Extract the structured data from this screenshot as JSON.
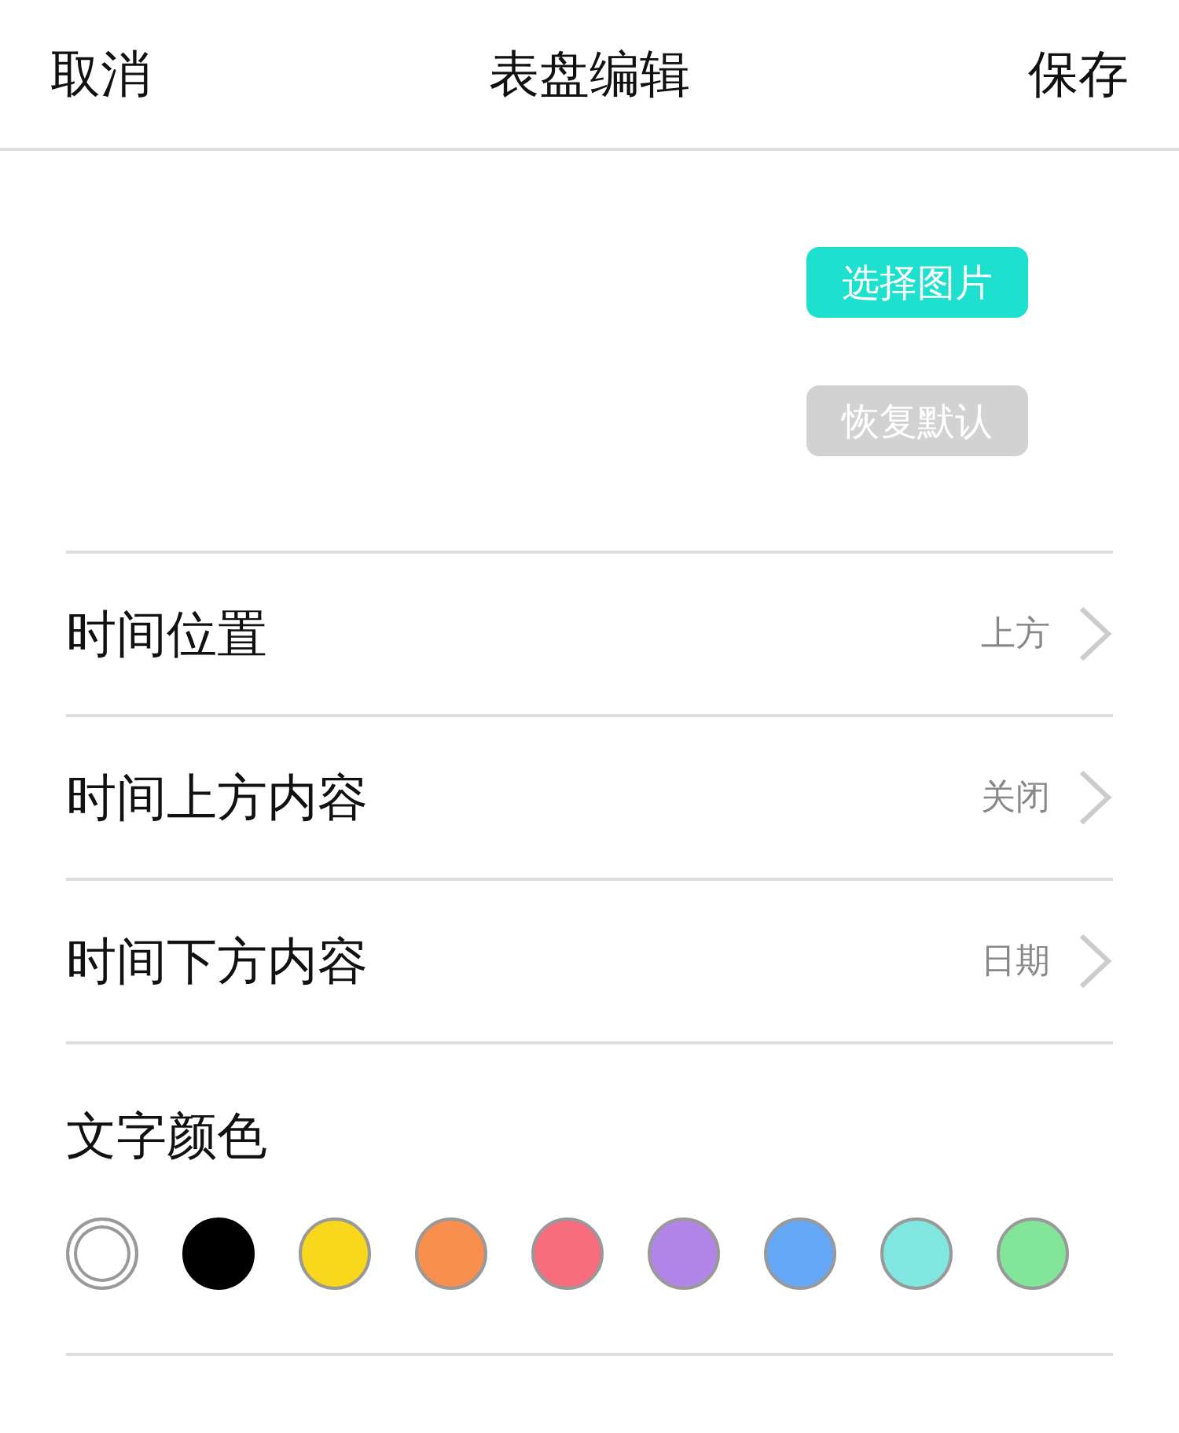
{
  "header": {
    "cancel": "取消",
    "title": "表盘编辑",
    "save": "保存"
  },
  "image_buttons": [
    {
      "label": "选择图片",
      "disabled": false
    },
    {
      "label": "恢复默认",
      "disabled": true
    }
  ],
  "settings": [
    {
      "label": "时间位置",
      "value": "上方"
    },
    {
      "label": "时间上方内容",
      "value": "关闭"
    },
    {
      "label": "时间下方内容",
      "value": "日期"
    }
  ],
  "text_color": {
    "label": "文字颜色",
    "swatches": [
      {
        "color": "#ffffff",
        "selected": true
      },
      {
        "color": "#000000",
        "selected": false
      },
      {
        "color": "#f9d71c",
        "selected": false
      },
      {
        "color": "#f88f4e",
        "selected": false
      },
      {
        "color": "#f76d7d",
        "selected": false
      },
      {
        "color": "#b286e8",
        "selected": false
      },
      {
        "color": "#64a8f7",
        "selected": false
      },
      {
        "color": "#80e6df",
        "selected": false
      },
      {
        "color": "#82e59a",
        "selected": false
      }
    ]
  }
}
